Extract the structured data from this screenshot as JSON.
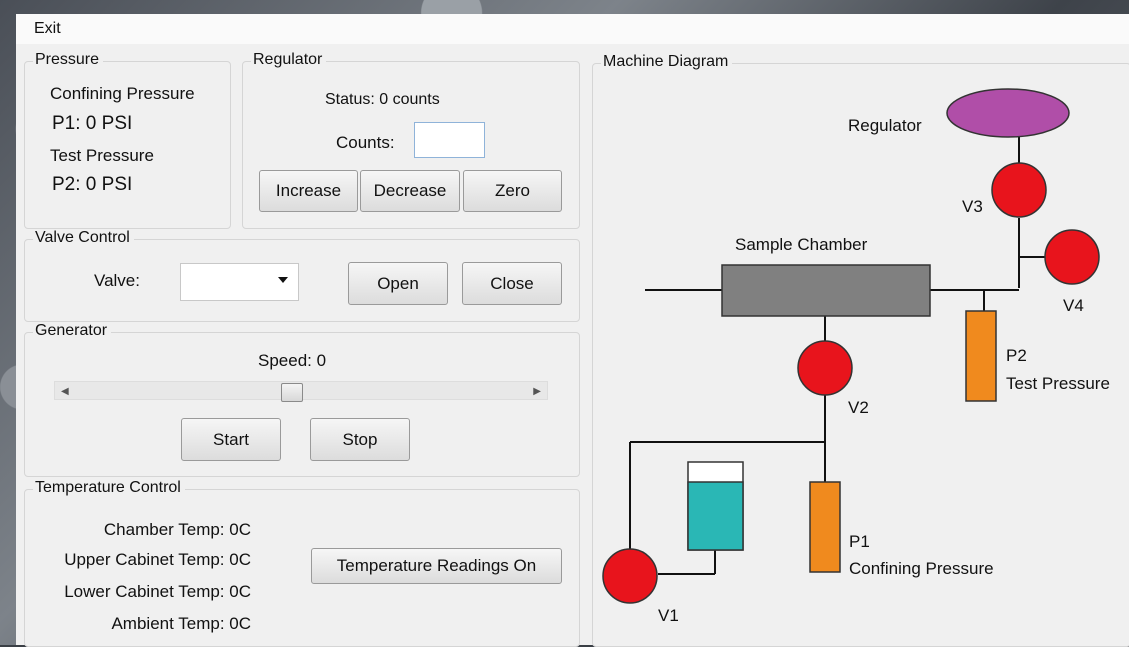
{
  "menu": {
    "exit": "Exit"
  },
  "pressure": {
    "title": "Pressure",
    "confining_label": "Confining Pressure",
    "p1": "P1: 0 PSI",
    "test_label": "Test Pressure",
    "p2": "P2: 0 PSI"
  },
  "regulator": {
    "title": "Regulator",
    "status": "Status: 0 counts",
    "counts_label": "Counts:",
    "counts_value": "",
    "increase": "Increase",
    "decrease": "Decrease",
    "zero": "Zero"
  },
  "valve_control": {
    "title": "Valve Control",
    "valve_label": "Valve:",
    "valve_selected": "",
    "open": "Open",
    "close": "Close"
  },
  "generator": {
    "title": "Generator",
    "speed": "Speed: 0",
    "slider_level": 0.48,
    "start": "Start",
    "stop": "Stop"
  },
  "temperature": {
    "title": "Temperature Control",
    "chamber": "Chamber Temp: 0C",
    "upper": "Upper Cabinet Temp: 0C",
    "lower": "Lower Cabinet Temp: 0C",
    "ambient": "Ambient Temp: 0C",
    "toggle": "Temperature Readings On"
  },
  "diagram": {
    "title": "Machine Diagram",
    "regulator": "Regulator",
    "sample_chamber": "Sample Chamber",
    "v1": "V1",
    "v2": "V2",
    "v3": "V3",
    "v4": "V4",
    "p1": "P1",
    "p1_desc": "Confining Pressure",
    "p2": "P2",
    "p2_desc": "Test Pressure",
    "colors": {
      "valve": "#e8141c",
      "regulator": "#b04ea8",
      "chamber": "#808080",
      "gauge": "#f08a1e",
      "tank": "#2ab7b5"
    }
  }
}
